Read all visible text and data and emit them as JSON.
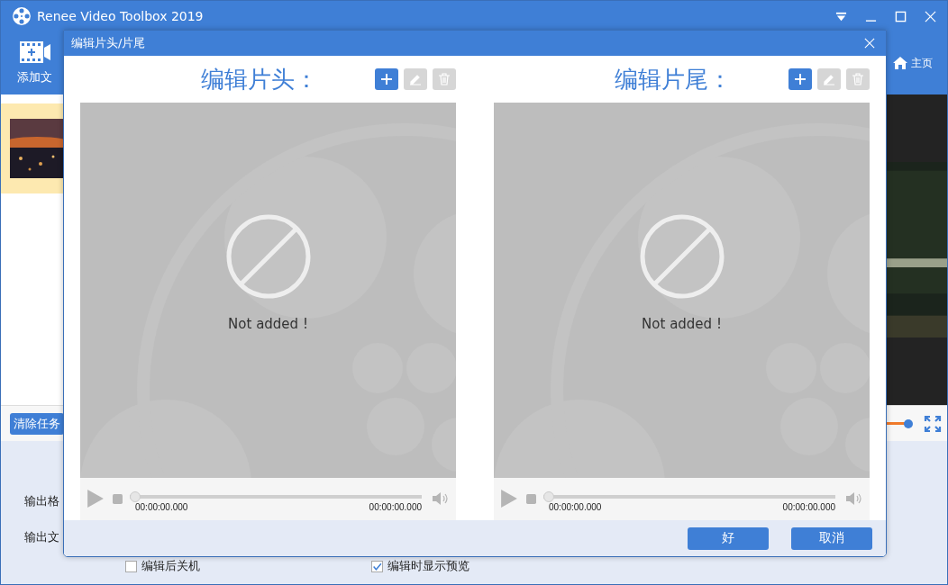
{
  "window": {
    "title": "Renee Video Toolbox 2019"
  },
  "toolbar": {
    "add_file": "添加文",
    "home": "主页"
  },
  "task_list": [
    {
      "kind": "picture",
      "selected": true
    }
  ],
  "clear_button": "清除任务",
  "volume": {
    "level": 1
  },
  "output_labels": [
    "输出格",
    "输出文"
  ],
  "options": [
    {
      "label": "编辑后关机",
      "checked": false
    },
    {
      "label": "编辑时显示预览",
      "checked": true
    }
  ],
  "dialog": {
    "title": "编辑片头/片尾",
    "panels": [
      {
        "heading": "编辑片头：",
        "status": "Not added !",
        "start_time": "00:00:00.000",
        "end_time": "00:00:00.000",
        "progress": {
          "level": 0
        },
        "tools": [
          {
            "kind": "add",
            "disabled": false
          },
          {
            "kind": "edit",
            "disabled": true
          },
          {
            "kind": "delete",
            "disabled": true
          }
        ]
      },
      {
        "heading": "编辑片尾：",
        "status": "Not added !",
        "start_time": "00:00:00.000",
        "end_time": "00:00:00.000",
        "progress": {
          "level": 0
        },
        "tools": [
          {
            "kind": "add",
            "disabled": false
          },
          {
            "kind": "edit",
            "disabled": true
          },
          {
            "kind": "delete",
            "disabled": true
          }
        ]
      }
    ],
    "buttons": [
      "好",
      "取消"
    ]
  }
}
